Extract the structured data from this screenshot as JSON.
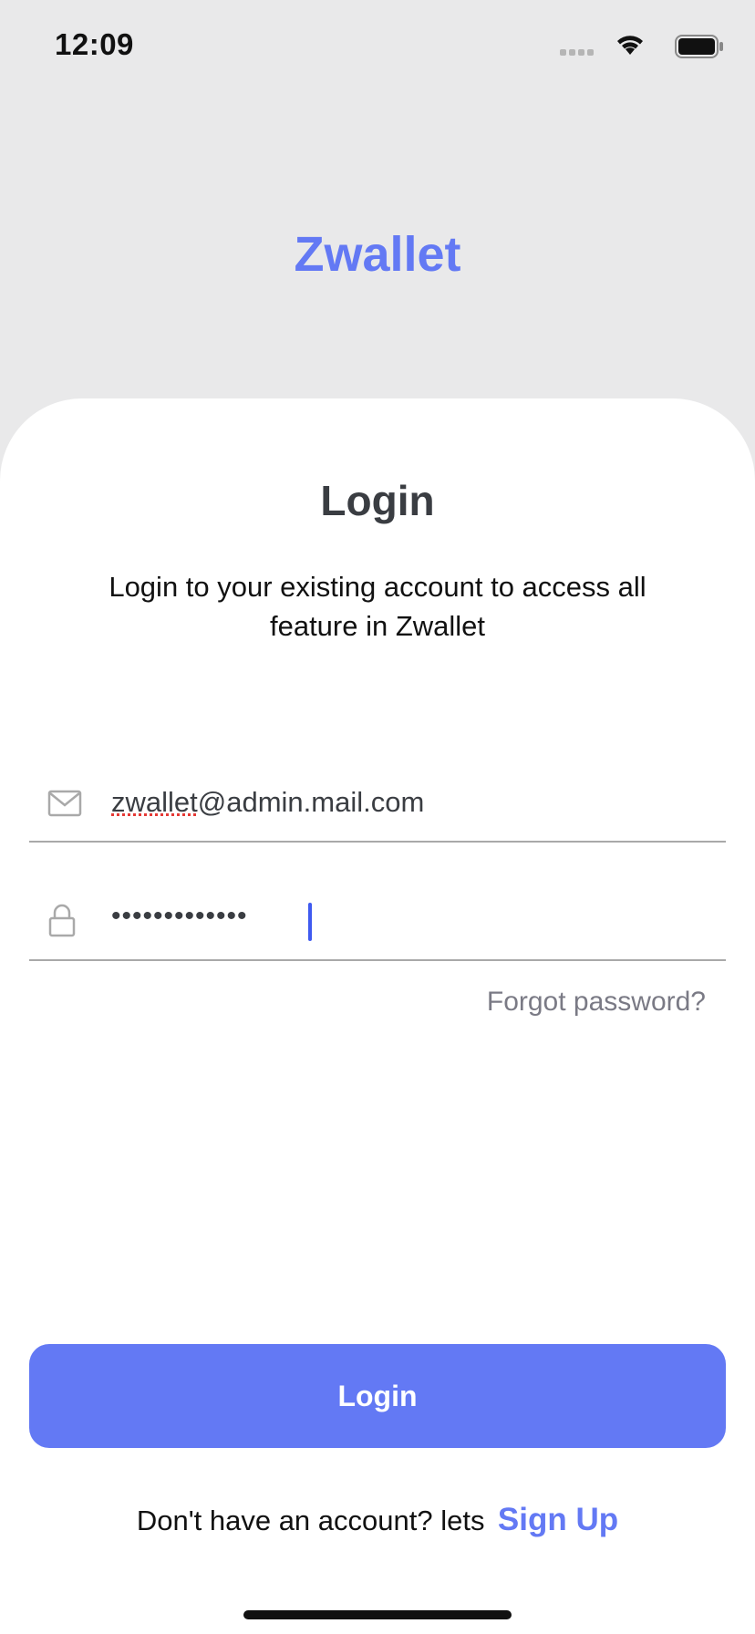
{
  "status_bar": {
    "time": "12:09",
    "icons": [
      "signal-icon",
      "wifi-icon",
      "battery-icon"
    ]
  },
  "app": {
    "title": "Zwallet",
    "accent_color": "#6379f4"
  },
  "login": {
    "heading": "Login",
    "description": "Login to your existing account to access all feature in Zwallet",
    "email": {
      "icon": "mail-icon",
      "value_part1": "zwallet",
      "value_part2": "@admin.mail.com"
    },
    "password": {
      "icon": "lock-icon",
      "masked_value": "•••••••••••••"
    },
    "forgot_password_label": "Forgot password?",
    "login_button_label": "Login",
    "signup_prompt": "Don't have an account? lets",
    "signup_link_label": "Sign Up"
  }
}
